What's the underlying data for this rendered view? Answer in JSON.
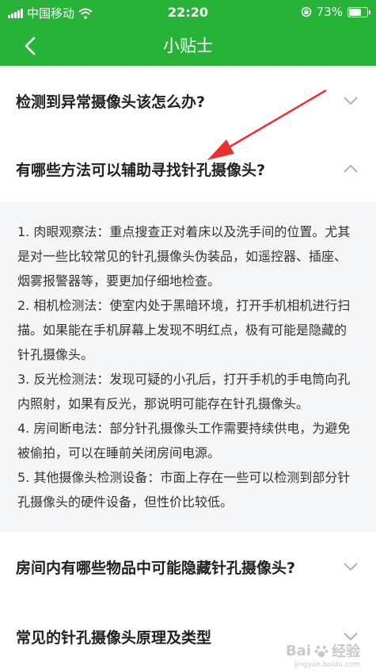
{
  "status": {
    "carrier": "中国移动",
    "time": "22:20",
    "battery": "73%",
    "battery_level": 0.73
  },
  "nav": {
    "title": "小贴士"
  },
  "faq": {
    "q1": "检测到异常摄像头该怎么办?",
    "q2": "有哪些方法可以辅助寻找针孔摄像头?",
    "a2": [
      "1. 肉眼观察法：重点搜查正对着床以及洗手间的位置。尤其是对一些比较常见的针孔摄像头伪装品，如遥控器、插座、烟雾报警器等，要更加仔细地检查。",
      "2. 相机检测法：使室内处于黑暗环境，打开手机相机进行扫描。如果能在手机屏幕上发现不明红点，极有可能是隐藏的针孔摄像头。",
      "3. 反光检测法：发现可疑的小孔后，打开手机的手电筒向孔内照射，如果有反光，那说明可能存在针孔摄像头。",
      "4. 房间断电法：部分针孔摄像头工作需要持续供电，为避免被偷拍，可以在睡前关闭房间电源。",
      "5. 其他摄像头检测设备：市面上存在一些可以检测到部分针孔摄像头的硬件设备，但性价比较低。"
    ],
    "q3": "房间内有哪些物品中可能隐藏针孔摄像头?",
    "q4": "常见的针孔摄像头原理及类型"
  },
  "watermark": {
    "text": "Bai",
    "suffix": "经验",
    "sub": "jingyan.baidu.com"
  },
  "colors": {
    "header": "#27b338",
    "arrow": "#e8332c",
    "answer_bg": "#f5f6f8"
  }
}
